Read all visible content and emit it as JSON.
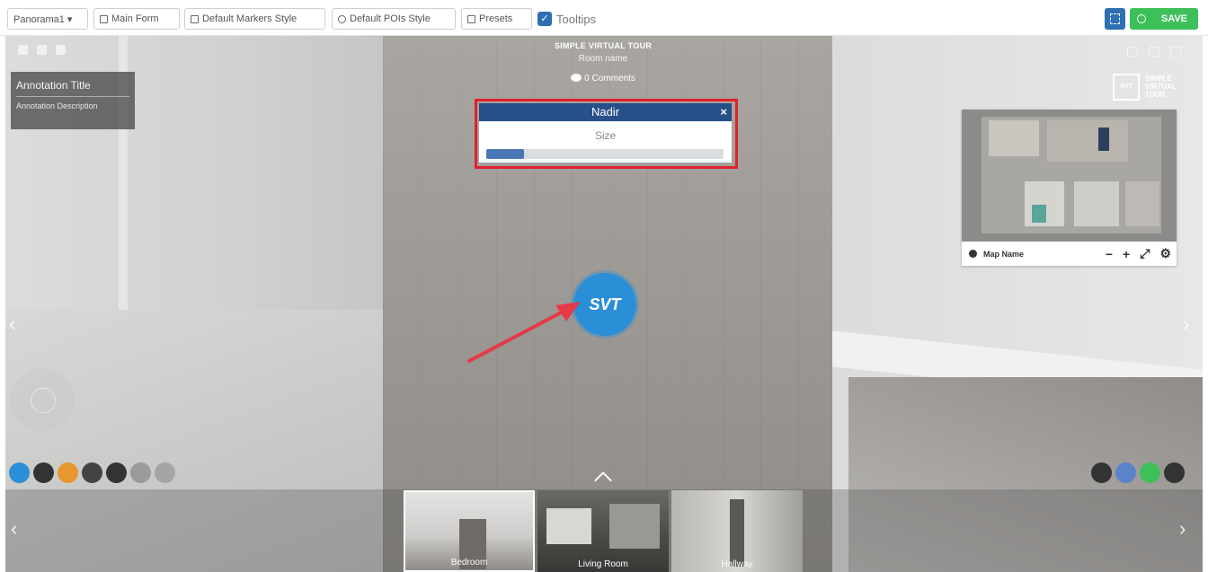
{
  "toolbar": {
    "panorama_select": "Panorama1 ▾",
    "main_form": "Main Form",
    "default_markers_style": "Default Markers Style",
    "default_pois_style": "Default POIs Style",
    "presets": "Presets",
    "tooltips_label": "Tooltips",
    "tooltips_checked": true,
    "save_label": "SAVE",
    "save_color": "#3fbf5a",
    "accent_color": "#2f6fb3"
  },
  "viewer": {
    "annotation": {
      "title": "Annotation Title",
      "description": "Annotation Description"
    },
    "tour_title": "SIMPLE VIRTUAL TOUR",
    "room_name": "Room name",
    "comments": "0 Comments",
    "logo_text": "SIMPLE VIRTUAL TOUR",
    "logo_box": "SVT"
  },
  "nadir": {
    "title": "Nadir",
    "close": "×",
    "size_label": "Size",
    "size_fraction": 0.16,
    "header_color": "#27508a",
    "highlight_color": "#e0202a",
    "logo_text": "SVT"
  },
  "map": {
    "name": "Map Name",
    "zoom_out": "−",
    "zoom_in": "+",
    "expand": "⤢",
    "settings": "⚙"
  },
  "left_buttons": [
    {
      "name": "info-button",
      "color": "#2b8fd8"
    },
    {
      "name": "info-dark-button",
      "color": "#333333"
    },
    {
      "name": "heart-button",
      "color": "#e8962e"
    },
    {
      "name": "chat-button",
      "color": "#444444"
    },
    {
      "name": "location-button",
      "color": "#333333"
    },
    {
      "name": "grey-button-1",
      "color": "#9a9a9a"
    },
    {
      "name": "grey-button-2",
      "color": "#a5a5a5"
    }
  ],
  "right_buttons": [
    {
      "name": "audio-button",
      "color": "#333333"
    },
    {
      "name": "vr-button",
      "color": "#5a83c9"
    },
    {
      "name": "whatsapp-button",
      "color": "#3fbf5a"
    },
    {
      "name": "mic-button",
      "color": "#333333"
    }
  ],
  "thumbnails": [
    {
      "label": "Bedroom"
    },
    {
      "label": "Living Room"
    },
    {
      "label": "Hallway"
    }
  ]
}
